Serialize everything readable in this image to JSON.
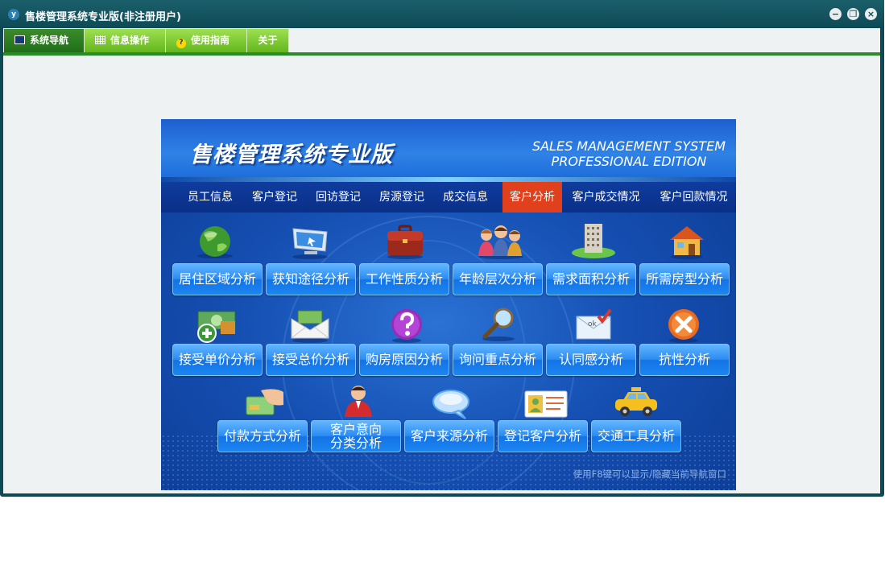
{
  "window": {
    "title": "售楼管理系统专业版(非注册用户)",
    "app_icon_text": "y"
  },
  "window_controls": {
    "minimize": "−",
    "restore": "❐",
    "close": "×"
  },
  "menu": {
    "tabs": [
      {
        "label": "系统导航",
        "icon": "monitor-icon",
        "active": true
      },
      {
        "label": "信息操作",
        "icon": "grid-icon",
        "active": false
      },
      {
        "label": "使用指南",
        "icon": "help-icon",
        "active": false
      },
      {
        "label": "关于",
        "icon": "",
        "active": false
      }
    ],
    "help_glyph": "?"
  },
  "panel": {
    "title_cn": "售楼管理系统专业版",
    "title_en_line1": "SALES MANAGEMENT SYSTEM",
    "title_en_line2": "PROFESSIONAL EDITION",
    "nav": [
      {
        "label": "员工信息",
        "active": false
      },
      {
        "label": "客户登记",
        "active": false
      },
      {
        "label": "回访登记",
        "active": false
      },
      {
        "label": "房源登记",
        "active": false
      },
      {
        "label": "成交信息",
        "active": false
      },
      {
        "label": "客户分析",
        "active": true
      },
      {
        "label": "客户成交情况",
        "active": false
      },
      {
        "label": "客户回款情况",
        "active": false
      }
    ],
    "tiles": [
      {
        "label": "居住区域分析",
        "icon": "globe-icon"
      },
      {
        "label": "获知途径分析",
        "icon": "monitor-icon"
      },
      {
        "label": "工作性质分析",
        "icon": "briefcase-icon"
      },
      {
        "label": "年龄层次分析",
        "icon": "family-icon"
      },
      {
        "label": "需求面积分析",
        "icon": "building-icon"
      },
      {
        "label": "所需房型分析",
        "icon": "house-icon"
      },
      {
        "label": "接受单价分析",
        "icon": "money-add-icon"
      },
      {
        "label": "接受总价分析",
        "icon": "money-envelope-icon"
      },
      {
        "label": "购房原因分析",
        "icon": "question-icon"
      },
      {
        "label": "询问重点分析",
        "icon": "magnifier-icon"
      },
      {
        "label": "认同感分析",
        "icon": "ok-mail-icon"
      },
      {
        "label": "抗性分析",
        "icon": "close-circle-icon"
      },
      {
        "label": "付款方式分析",
        "icon": "card-payment-icon"
      },
      {
        "label": "客户意向分类分析",
        "label_line1": "客户意向",
        "label_line2": "分类分析",
        "icon": "customer-icon"
      },
      {
        "label": "客户来源分析",
        "icon": "chat-bubble-icon"
      },
      {
        "label": "登记客户分析",
        "icon": "id-card-icon"
      },
      {
        "label": "交通工具分析",
        "icon": "taxi-icon"
      }
    ],
    "ok_text": "ok",
    "hint": "使用F8键可以显示/隐藏当前导航窗口"
  },
  "colors": {
    "title_bar": "#0e4a55",
    "menu_active": "#1f6e18",
    "menu_tab": "#63b61e",
    "panel_blue": "#1650b3",
    "nav_active": "#e0401c",
    "tile_button": "#2d8cf2"
  }
}
